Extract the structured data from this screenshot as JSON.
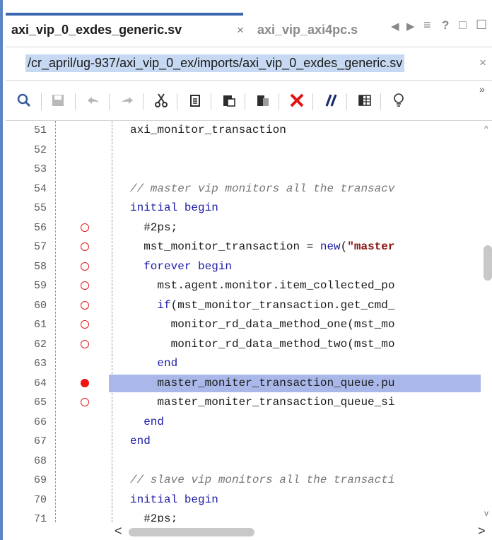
{
  "tabs": [
    {
      "label": "axi_vip_0_exdes_generic.sv",
      "active": true
    },
    {
      "label": "axi_vip_axi4pc.s",
      "active": false
    }
  ],
  "tab_controls": {
    "prev": "◀",
    "next": "▶",
    "menu": "≡",
    "help": "?",
    "restore": "□",
    "float": "☐"
  },
  "path": {
    "text": "/cr_april/ug-937/axi_vip_0_ex/imports/axi_vip_0_exdes_generic.sv",
    "close": "×"
  },
  "toolbar": {
    "icons": [
      "search-icon",
      "save-icon",
      "undo-icon",
      "redo-icon",
      "cut-icon",
      "copy-icon",
      "paste-icon",
      "delete-icon",
      "comment-icon",
      "column-select-icon",
      "bulb-icon"
    ],
    "overflow": "»"
  },
  "editor": {
    "lines": [
      {
        "num": "51",
        "bp": "none",
        "code": [
          {
            "t": "axi_monitor_transaction",
            "c": ""
          }
        ]
      },
      {
        "num": "52",
        "bp": "none",
        "code": []
      },
      {
        "num": "53",
        "bp": "none",
        "code": []
      },
      {
        "num": "54",
        "bp": "none",
        "code": [
          {
            "t": "// master vip monitors all the transacv",
            "c": "cmt"
          }
        ]
      },
      {
        "num": "55",
        "bp": "none",
        "code": [
          {
            "t": "initial begin",
            "c": "kw"
          }
        ]
      },
      {
        "num": "56",
        "bp": "open",
        "code": [
          {
            "t": "  #2ps;",
            "c": ""
          }
        ]
      },
      {
        "num": "57",
        "bp": "open",
        "code": [
          {
            "t": "  mst_monitor_transaction = ",
            "c": ""
          },
          {
            "t": "new",
            "c": "kw"
          },
          {
            "t": "(",
            "c": ""
          },
          {
            "t": "\"master",
            "c": "str"
          }
        ]
      },
      {
        "num": "58",
        "bp": "open",
        "code": [
          {
            "t": "  forever begin",
            "c": "kw"
          }
        ]
      },
      {
        "num": "59",
        "bp": "open",
        "code": [
          {
            "t": "    mst.agent.monitor.item_collected_po",
            "c": ""
          }
        ]
      },
      {
        "num": "60",
        "bp": "open",
        "code": [
          {
            "t": "    ",
            "c": ""
          },
          {
            "t": "if",
            "c": "kw"
          },
          {
            "t": "(mst_monitor_transaction.get_cmd_",
            "c": ""
          }
        ]
      },
      {
        "num": "61",
        "bp": "open",
        "code": [
          {
            "t": "      monitor_rd_data_method_one(mst_mo",
            "c": ""
          }
        ]
      },
      {
        "num": "62",
        "bp": "open",
        "code": [
          {
            "t": "      monitor_rd_data_method_two(mst_mo",
            "c": ""
          }
        ]
      },
      {
        "num": "63",
        "bp": "none",
        "code": [
          {
            "t": "    end",
            "c": "kw"
          }
        ]
      },
      {
        "num": "64",
        "bp": "filled",
        "hl": true,
        "code": [
          {
            "t": "    master_moniter_transaction_queue.pu",
            "c": ""
          }
        ]
      },
      {
        "num": "65",
        "bp": "open",
        "code": [
          {
            "t": "    master_moniter_transaction_queue_si",
            "c": ""
          }
        ]
      },
      {
        "num": "66",
        "bp": "none",
        "code": [
          {
            "t": "  end",
            "c": "kw"
          }
        ]
      },
      {
        "num": "67",
        "bp": "none",
        "code": [
          {
            "t": "end",
            "c": "kw"
          }
        ]
      },
      {
        "num": "68",
        "bp": "none",
        "code": []
      },
      {
        "num": "69",
        "bp": "none",
        "code": [
          {
            "t": "// slave vip monitors all the transacti",
            "c": "cmt"
          }
        ]
      },
      {
        "num": "70",
        "bp": "none",
        "code": [
          {
            "t": "initial begin",
            "c": "kw"
          }
        ]
      },
      {
        "num": "71",
        "bp": "none",
        "code": [
          {
            "t": "  #2ps;",
            "c": ""
          }
        ]
      }
    ]
  },
  "scroll": {
    "left": "<",
    "right": ">",
    "up": "^",
    "down": "v"
  }
}
